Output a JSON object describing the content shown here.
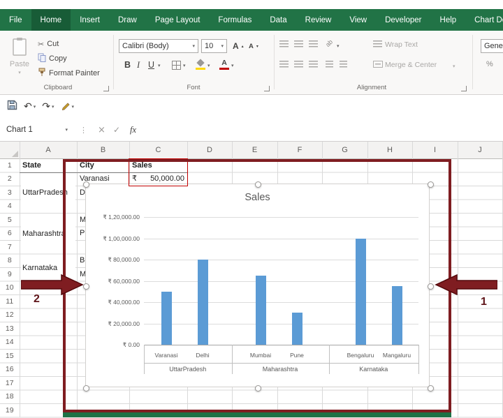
{
  "colors": {
    "excel_green": "#217346",
    "active_tab_green": "#185c37",
    "bar_color": "#5b9bd5",
    "annotation_red": "#7f1d21",
    "cell_highlight_red": "#c00000"
  },
  "icons": {
    "caret": "▾",
    "scissors": "✂",
    "undo": "↶",
    "redo": "↷",
    "cancel": "×",
    "enter": "✓",
    "dots": "⋮",
    "font_a": "A",
    "up": "▴",
    "down": "▾",
    "percent": "%",
    "orientation": "ab"
  },
  "tabs": [
    {
      "label": "File",
      "active": false
    },
    {
      "label": "Home",
      "active": true
    },
    {
      "label": "Insert",
      "active": false
    },
    {
      "label": "Draw",
      "active": false
    },
    {
      "label": "Page Layout",
      "active": false
    },
    {
      "label": "Formulas",
      "active": false
    },
    {
      "label": "Data",
      "active": false
    },
    {
      "label": "Review",
      "active": false
    },
    {
      "label": "View",
      "active": false
    },
    {
      "label": "Developer",
      "active": false
    },
    {
      "label": "Help",
      "active": false
    },
    {
      "label": "Chart Des",
      "active": false
    }
  ],
  "ribbon": {
    "clipboard": {
      "group_label": "Clipboard",
      "paste": "Paste",
      "cut": "Cut",
      "copy": "Copy",
      "format_painter": "Format Painter"
    },
    "font": {
      "group_label": "Font",
      "font_name": "Calibri (Body)",
      "font_size": "10",
      "bold": "B",
      "italic": "I",
      "underline": "U"
    },
    "alignment": {
      "group_label": "Alignment",
      "wrap_text": "Wrap Text",
      "merge_center": "Merge & Center"
    },
    "number": {
      "format_value": "Gene"
    }
  },
  "formula_bar": {
    "name_box": "Chart 1",
    "fx": "fx",
    "formula": ""
  },
  "sheet": {
    "col_headers": [
      "A",
      "B",
      "C",
      "D",
      "E",
      "F",
      "G",
      "H",
      "I",
      "J"
    ],
    "row_headers": [
      "1",
      "2",
      "3",
      "4",
      "5",
      "6",
      "7",
      "8",
      "9",
      "10",
      "11",
      "12",
      "13",
      "14",
      "15",
      "16",
      "17",
      "18",
      "19"
    ],
    "cells": [
      {
        "row": 1,
        "col": "A",
        "text": "State",
        "bold": true
      },
      {
        "row": 1,
        "col": "B",
        "text": "City",
        "bold": true
      },
      {
        "row": 1,
        "col": "C",
        "text": "Sales",
        "bold": true
      },
      {
        "row": 2,
        "col": "B",
        "text": "Varanasi"
      },
      {
        "row": 2,
        "col": "C",
        "currency": "₹",
        "text": "50,000.00"
      },
      {
        "row": 3,
        "col": "B",
        "text": "Delhi"
      },
      {
        "row": 5,
        "col": "B",
        "text": "Mumbai"
      },
      {
        "row": 6,
        "col": "B",
        "text": "Pune"
      },
      {
        "row": 8,
        "col": "B",
        "text": "Bengaluru"
      },
      {
        "row": 9,
        "col": "B",
        "text": "Mangaluru"
      }
    ],
    "merged_cells": [
      {
        "row": 2,
        "rowspan": 3,
        "col": "A",
        "text": "UttarPradesh"
      },
      {
        "row": 5,
        "rowspan": 3,
        "col": "A",
        "text": "Maharashtra"
      },
      {
        "row": 8,
        "rowspan": 2,
        "col": "A",
        "text": "Karnataka"
      }
    ]
  },
  "chart_data": {
    "type": "bar",
    "title": "Sales",
    "categories": [
      "Varanasi",
      "Delhi",
      "Mumbai",
      "Pune",
      "Bengaluru",
      "Mangaluru"
    ],
    "group_labels": [
      "UttarPradesh",
      "Maharashtra",
      "Karnataka"
    ],
    "values": [
      50000,
      80000,
      65000,
      30000,
      100000,
      55000
    ],
    "ylim": [
      0,
      120000
    ],
    "y_ticks": [
      "₹ 1,20,000.00",
      "₹ 1,00,000.00",
      "₹ 80,000.00",
      "₹ 60,000.00",
      "₹ 40,000.00",
      "₹ 20,000.00",
      "₹ 0.00"
    ],
    "grid": true,
    "legend": "none",
    "bar_color": "#5b9bd5"
  },
  "annotations": {
    "label_1": "1",
    "label_2": "2"
  }
}
